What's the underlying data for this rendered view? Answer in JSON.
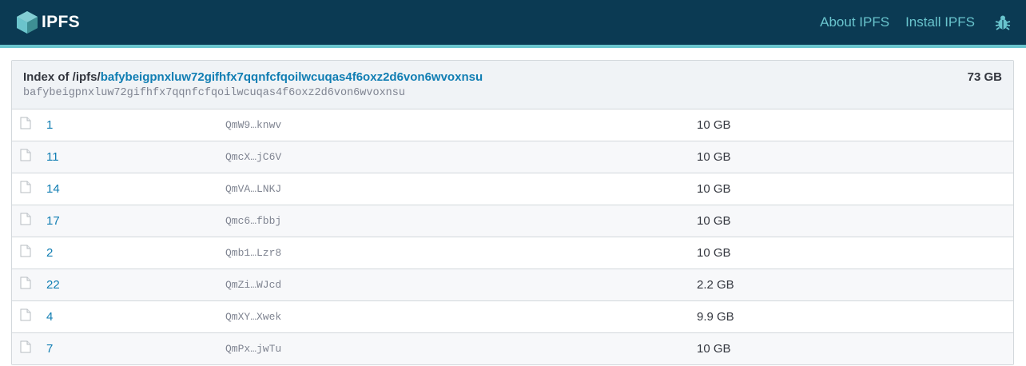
{
  "header": {
    "logo_text": "IPFS",
    "nav": [
      "About IPFS",
      "Install IPFS"
    ],
    "bug_icon": "bug-icon"
  },
  "listing": {
    "index_prefix": "Index of /ipfs/",
    "cid": "bafybeigpnxluw72gifhfx7qqnfcfqoilwcuqas4f6oxz2d6von6wvoxnsu",
    "cid_sub": "bafybeigpnxluw72gifhfx7qqnfcfqoilwcuqas4f6oxz2d6von6wvoxnsu",
    "total_size": "73 GB",
    "rows": [
      {
        "name": "1",
        "hash": "QmW9…knwv",
        "size": "10 GB"
      },
      {
        "name": "11",
        "hash": "QmcX…jC6V",
        "size": "10 GB"
      },
      {
        "name": "14",
        "hash": "QmVA…LNKJ",
        "size": "10 GB"
      },
      {
        "name": "17",
        "hash": "Qmc6…fbbj",
        "size": "10 GB"
      },
      {
        "name": "2",
        "hash": "Qmb1…Lzr8",
        "size": "10 GB"
      },
      {
        "name": "22",
        "hash": "QmZi…WJcd",
        "size": "2.2 GB"
      },
      {
        "name": "4",
        "hash": "QmXY…Xwek",
        "size": "9.9 GB"
      },
      {
        "name": "7",
        "hash": "QmPx…jwTu",
        "size": "10 GB"
      }
    ]
  },
  "colors": {
    "topbar": "#0b3a53",
    "accent": "#69c4cd",
    "link": "#117eb3"
  }
}
